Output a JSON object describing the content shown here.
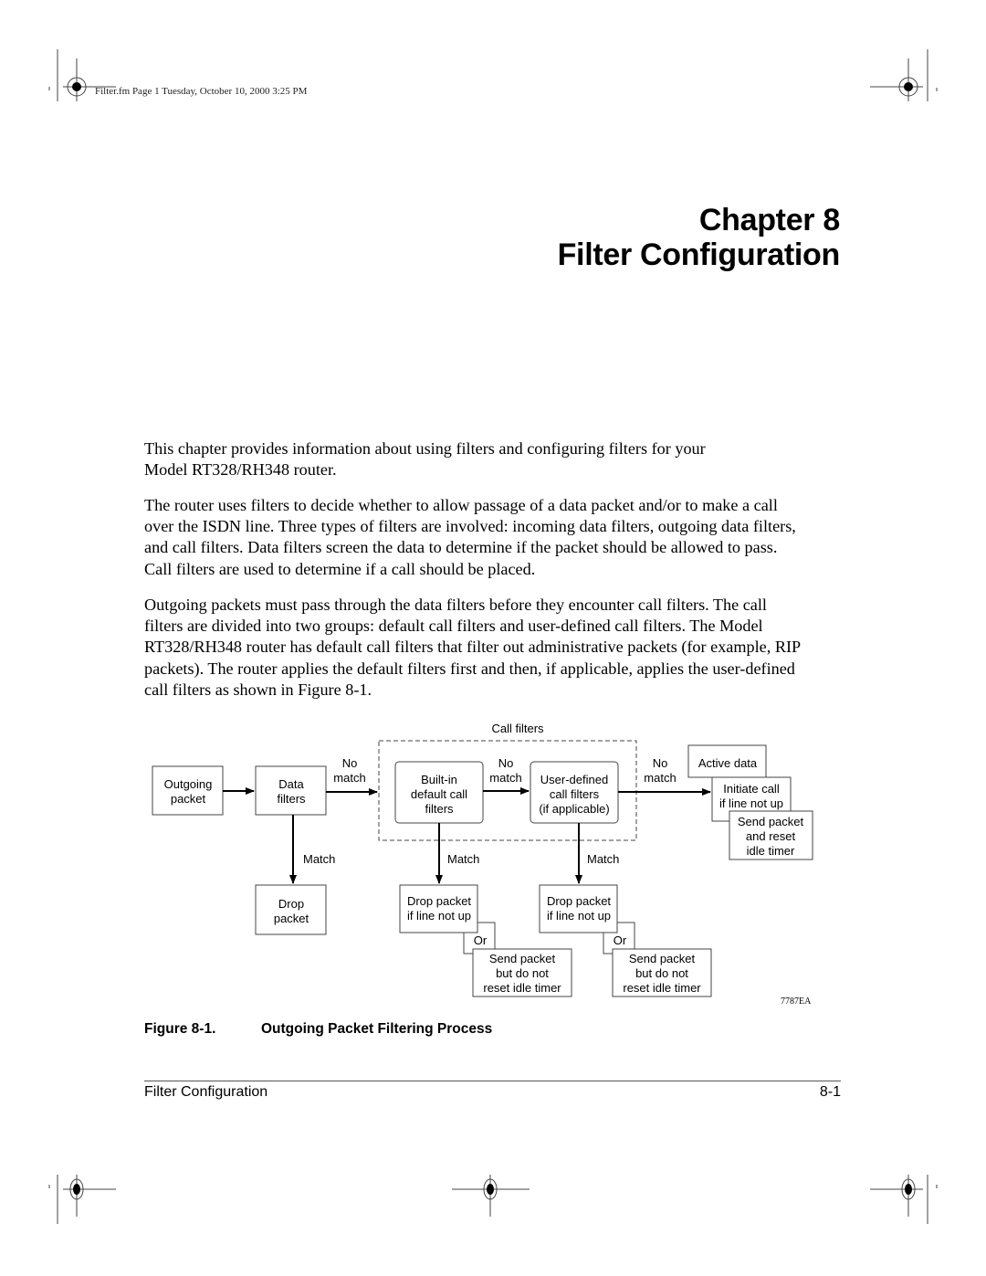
{
  "header": {
    "meta": "Filter.fm  Page 1  Tuesday, October 10, 2000  3:25 PM"
  },
  "chapter": {
    "number_line": "Chapter 8",
    "title": "Filter Configuration"
  },
  "paragraphs": [
    {
      "lines": [
        "This chapter provides information about using filters and configuring filters for your",
        "Model RT328/RH348 router."
      ]
    },
    {
      "lines": [
        "The router uses filters to decide whether to allow passage of a data packet and/or to make a call",
        "over the ISDN line. Three types of filters are involved: incoming data filters, outgoing data filters,",
        "and call filters. Data filters screen the data to determine if the packet should be allowed to pass.",
        "Call filters are used to determine if a call should be placed."
      ]
    },
    {
      "lines": [
        "Outgoing packets must pass through the data filters before they encounter call filters. The call",
        "filters are divided into two groups: default call filters and user-defined call filters. The Model",
        "RT328/RH348 router has default call filters that filter out administrative packets (for example, RIP",
        "packets). The router applies the default filters first and then, if applicable, applies the user-defined",
        "call filters as shown in Figure 8-1."
      ]
    }
  ],
  "diagram": {
    "group_label": "Call filters",
    "nodes": {
      "outgoing_packet": [
        "Outgoing",
        "packet"
      ],
      "data_filters": [
        "Data",
        "filters"
      ],
      "builtin_filters": [
        "Built-in",
        "default call",
        "filters"
      ],
      "user_filters": [
        "User-defined",
        "call filters",
        "(if applicable)"
      ],
      "active_data": [
        "Active data"
      ],
      "initiate_call": [
        "Initiate call",
        "if line not up"
      ],
      "send_reset": [
        "Send packet",
        "and reset",
        "idle timer"
      ],
      "drop_packet": [
        "Drop",
        "packet"
      ],
      "drop_if_down_1": [
        "Drop packet",
        "if line not up"
      ],
      "or_1": "Or",
      "send_no_reset_1": [
        "Send packet",
        "but do not",
        "reset idle timer"
      ],
      "drop_if_down_2": [
        "Drop packet",
        "if line not up"
      ],
      "or_2": "Or",
      "send_no_reset_2": [
        "Send packet",
        "but do not",
        "reset idle timer"
      ]
    },
    "edge_labels": {
      "no_match_1": [
        "No",
        "match"
      ],
      "no_match_2": [
        "No",
        "match"
      ],
      "no_match_3": [
        "No",
        "match"
      ],
      "match_1": "Match",
      "match_2": "Match",
      "match_3": "Match"
    },
    "figure_id": "7787EA"
  },
  "caption": {
    "number": "Figure 8-1.",
    "title": "Outgoing Packet Filtering Process"
  },
  "footer": {
    "section": "Filter Configuration",
    "page": "8-1"
  }
}
